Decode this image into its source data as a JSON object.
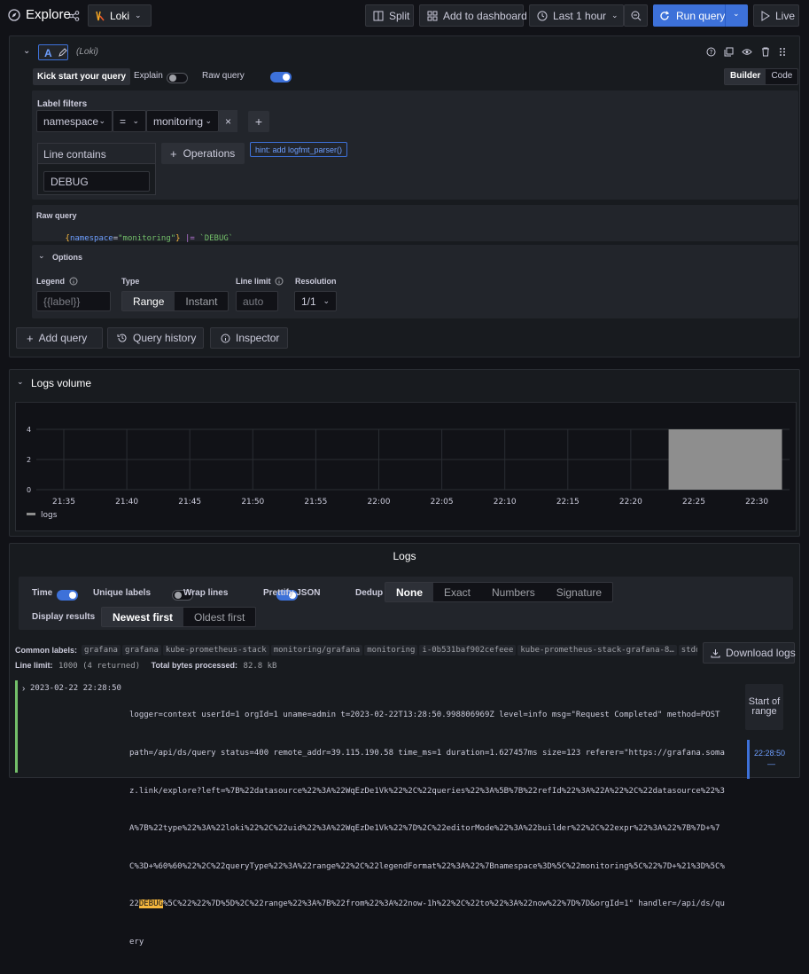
{
  "topbar": {
    "title": "Explore",
    "datasource": "Loki",
    "split": "Split",
    "add_dashboard": "Add to dashboard",
    "time_range": "Last 1 hour",
    "run_query": "Run query",
    "live": "Live"
  },
  "query": {
    "ref": "A",
    "ds_label": "(Loki)",
    "kick_start": "Kick start your query",
    "explain": "Explain",
    "raw_query_toggle": "Raw query",
    "mode_builder": "Builder",
    "mode_code": "Code",
    "label_filters_title": "Label filters",
    "filter": {
      "label": "namespace",
      "op": "=",
      "value": "monitoring"
    },
    "line_contains_title": "Line contains",
    "line_contains_value": "DEBUG",
    "operations": "Operations",
    "hint": "hint: add logfmt_parser()",
    "raw_query_title": "Raw query",
    "raw": {
      "brace_open": "{",
      "key": "namespace",
      "eq": "=",
      "val": "\"monitoring\"",
      "brace_close": "}",
      "op": " |= ",
      "str": "`DEBUG`"
    },
    "options_title": "Options",
    "legend_label": "Legend",
    "legend_placeholder": "{{label}}",
    "type_label": "Type",
    "type_range": "Range",
    "type_instant": "Instant",
    "line_limit_label": "Line limit",
    "line_limit_placeholder": "auto",
    "resolution_label": "Resolution",
    "resolution_value": "1/1",
    "add_query": "Add query",
    "query_history": "Query history",
    "inspector": "Inspector"
  },
  "volume": {
    "title": "Logs volume",
    "legend": "logs",
    "color": "#8e8e8e"
  },
  "chart_data": {
    "type": "bar",
    "x_ticks": [
      "21:35",
      "21:40",
      "21:45",
      "21:50",
      "21:55",
      "22:00",
      "22:05",
      "22:10",
      "22:15",
      "22:20",
      "22:25",
      "22:30"
    ],
    "y_ticks": [
      "0",
      "2",
      "4"
    ],
    "ylim": [
      0,
      4
    ],
    "series": [
      {
        "name": "logs",
        "bars": [
          {
            "start": "22:23",
            "end": "22:32",
            "value": 4
          }
        ]
      }
    ]
  },
  "logs": {
    "title": "Logs",
    "time": "Time",
    "unique_labels": "Unique labels",
    "wrap_lines": "Wrap lines",
    "prettify_json": "Prettify JSON",
    "dedup": "Dedup",
    "dedup_options": [
      "None",
      "Exact",
      "Numbers",
      "Signature"
    ],
    "display_results": "Display results",
    "order_newest": "Newest first",
    "order_oldest": "Oldest first",
    "common_labels_label": "Common labels:",
    "common_labels": [
      "grafana",
      "grafana",
      "kube-prometheus-stack",
      "monitoring/grafana",
      "monitoring",
      "i-0b531baf902cefeee",
      "kube-prometheus-stack-grafana-8…",
      "stdout"
    ],
    "line_limit_label": "Line limit:",
    "line_limit_value": "1000 (4 returned)",
    "bytes_label": "Total bytes processed:",
    "bytes_value": "82.8 kB",
    "download": "Download logs",
    "start_of_range": "Start of range",
    "range_time": "22:28:50",
    "range_dash": "—",
    "entry": {
      "timestamp": "2023-02-22 22:28:50",
      "line1": "logger=context userId=1 orgId=1 uname=admin t=2023-02-22T13:28:50.998806969Z level=info msg=\"Request Completed\" method=POST",
      "line2": "path=/api/ds/query status=400 remote_addr=39.115.190.58 time_ms=1 duration=1.627457ms size=123 referer=\"https://grafana.soma",
      "line3": "z.link/explore?left=%7B%22datasource%22%3A%22WqEzDe1Vk%22%2C%22queries%22%3A%5B%7B%22refId%22%3A%22A%22%2C%22datasource%22%3",
      "line4": "A%7B%22type%22%3A%22loki%22%2C%22uid%22%3A%22WqEzDe1Vk%22%7D%2C%22editorMode%22%3A%22builder%22%2C%22expr%22%3A%22%7B%7D+%7",
      "line5": "C%3D+%60%60%22%2C%22queryType%22%3A%22range%22%2C%22legendFormat%22%3A%22%7Bnamespace%3D%5C%22monitoring%5C%22%7D+%21%3D%5C%",
      "line6_pre": "22",
      "line6_hl": "DEBUG",
      "line6_post": "%5C%22%22%7D%5D%2C%22range%22%3A%7B%22from%22%3A%22now-1h%22%2C%22to%22%3A%22now%22%7D%7D&orgId=1\" handler=/api/ds/qu",
      "line7": "ery"
    }
  }
}
